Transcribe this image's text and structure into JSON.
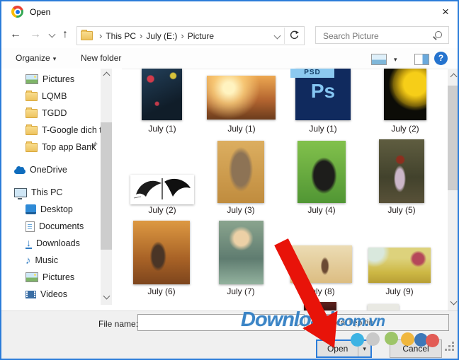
{
  "window": {
    "title": "Open",
    "app_icon": "chrome-logo"
  },
  "icons": {
    "close": "×",
    "back": "←",
    "forward": "→",
    "up": "↑",
    "caret": "▾",
    "crumb_sep": "›",
    "help": "?",
    "music_note": "♪",
    "download_arrow": "↓"
  },
  "navbar": {
    "breadcrumb": {
      "crumbs": [
        "This PC",
        "July (E:)",
        "Picture"
      ]
    },
    "search": {
      "placeholder": "Search Picture"
    }
  },
  "toolbar": {
    "organize_label": "Organize",
    "new_folder_label": "New folder"
  },
  "sidebar": {
    "items": [
      {
        "label": "Pictures",
        "icon": "pictures-icon",
        "pinned": true
      },
      {
        "label": "LQMB",
        "icon": "folder-icon"
      },
      {
        "label": "TGDD",
        "icon": "folder-icon"
      },
      {
        "label": "T-Google dich tv",
        "icon": "folder-icon"
      },
      {
        "label": "Top app Bank",
        "icon": "folder-icon"
      },
      {
        "label": "OneDrive",
        "icon": "onedrive-cloud-icon"
      },
      {
        "label": "This PC",
        "icon": "computer-icon"
      },
      {
        "label": "Desktop",
        "icon": "desktop-icon"
      },
      {
        "label": "Documents",
        "icon": "documents-icon"
      },
      {
        "label": "Downloads",
        "icon": "downloads-icon"
      },
      {
        "label": "Music",
        "icon": "music-icon"
      },
      {
        "label": "Pictures",
        "icon": "pictures-icon"
      },
      {
        "label": "Videos",
        "icon": "videos-icon"
      }
    ]
  },
  "files": {
    "psd": {
      "logo": "Ps",
      "ribbon": "PSD"
    },
    "items": [
      {
        "label": "July (1)",
        "desc": "dark blue leaves with butterflies photo"
      },
      {
        "label": "July (1)",
        "desc": "warm sunset couple photo"
      },
      {
        "label": "July (1)",
        "desc": "Photoshop PSD file"
      },
      {
        "label": "July (2)",
        "desc": "yellow sunflower on black photo"
      },
      {
        "label": "July (2)",
        "desc": "black wing tattoo drawing on white"
      },
      {
        "label": "July (3)",
        "desc": "cat lying on wooden floor photo"
      },
      {
        "label": "July (4)",
        "desc": "gorilla on green grass photo"
      },
      {
        "label": "July (5)",
        "desc": "woman in orchard photo"
      },
      {
        "label": "July (6)",
        "desc": "boy with cat on dirt road photo"
      },
      {
        "label": "July (7)",
        "desc": "girl with flowers photo"
      },
      {
        "label": "July (8)",
        "desc": "woman in sepia field photo"
      },
      {
        "label": "July (9)",
        "desc": "girl with red beret in yellow field photo"
      }
    ]
  },
  "footer": {
    "file_name_label": "File name:",
    "file_name_value": "",
    "file_type_value": "Tất cả Tệp tin",
    "open_label": "Open",
    "cancel_label": "Cancel"
  },
  "watermark": {
    "text": "Download",
    "suffix": ".com.vn",
    "color": "#2e7cc2"
  },
  "annotation": {
    "arrow_color": "#e81309",
    "dot_colors": [
      "#3db3e3",
      "#c9c9c9",
      "#9dc568",
      "#f0b73e",
      "#3d78b8",
      "#e25b55"
    ]
  },
  "colors": {
    "window_border": "#2b7cd9",
    "focus_border": "#2b7cd9",
    "footer_bg": "#f0f0f0",
    "help_blue": "#2573ce"
  }
}
